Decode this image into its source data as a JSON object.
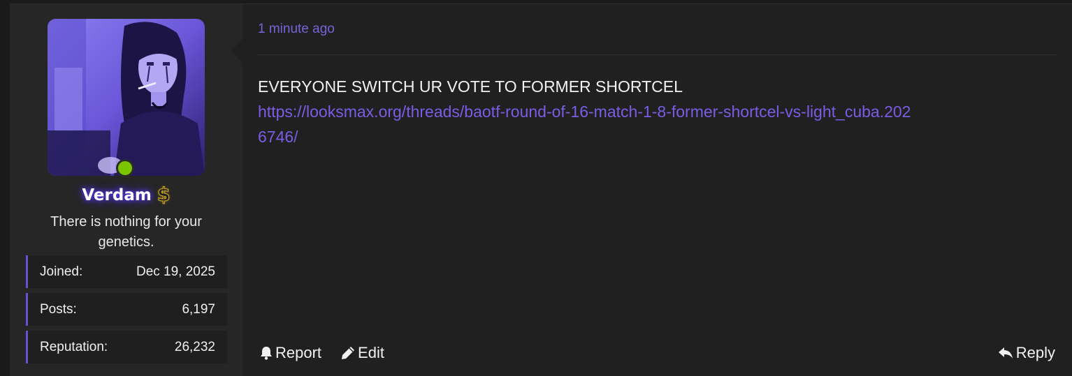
{
  "user": {
    "name": "Verdam",
    "title": "There is nothing for your genetics.",
    "online": true,
    "stats": [
      {
        "label": "Joined:",
        "value": "Dec 19, 2025"
      },
      {
        "label": "Posts:",
        "value": "6,197"
      },
      {
        "label": "Reputation:",
        "value": "26,232"
      }
    ],
    "badge_icon": "dollar-sign-icon"
  },
  "post": {
    "time": "1 minute ago",
    "text": "EVERYONE SWITCH UR VOTE TO FORMER SHORTCEL",
    "link": "https://looksmax.org/threads/baotf-round-of-16-match-1-8-former-shortcel-vs-light_cuba.2026746/"
  },
  "actions": {
    "report": "Report",
    "edit": "Edit",
    "reply": "Reply"
  },
  "colors": {
    "accent": "#6d4fd6",
    "link": "#7a5de6",
    "online": "#7bc400"
  }
}
